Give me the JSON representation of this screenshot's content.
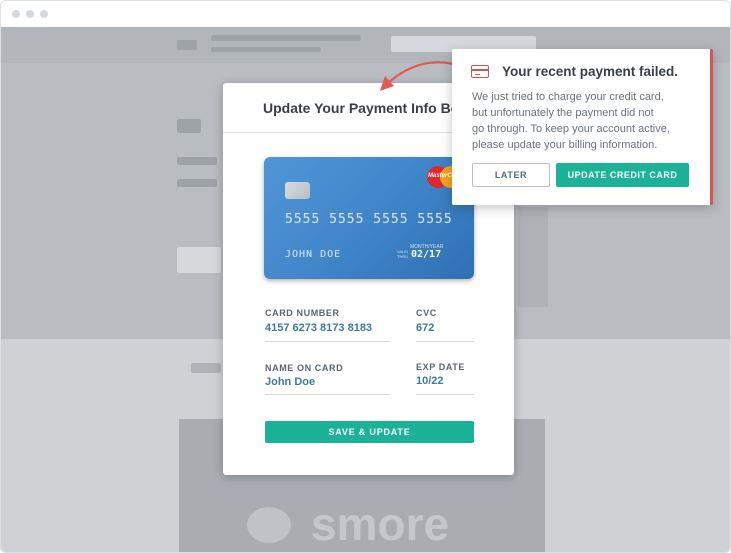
{
  "modal": {
    "title": "Update Your Payment Info Belo"
  },
  "card": {
    "number": "5555 5555 5555 5555",
    "holder": "JOHN DOE",
    "brand": "MasterCard",
    "valid_label": "MONTH/YEAR",
    "valid_thru": "VALID THRU",
    "expiry": "02/17"
  },
  "form": {
    "card_number_label": "CARD NUMBER",
    "card_number_value": "4157 6273 8173 8183",
    "cvc_label": "CVC",
    "cvc_value": "672",
    "name_label": "NAME ON CARD",
    "name_value": "John Doe",
    "exp_label": "EXP DATE",
    "exp_value": "10/22",
    "save_label": "SAVE & UPDATE"
  },
  "popover": {
    "title": "Your recent payment failed.",
    "body_lines": [
      "We just tried to charge your credit card,",
      "but unfortunately the payment did not",
      "go through. To keep your account active,",
      "please update your billing information."
    ],
    "later_label": "LATER",
    "update_label": "UPDATE CREDIT CARD",
    "icon": "credit-card-icon"
  },
  "background_logo": "smore",
  "colors": {
    "accent": "#1ab398",
    "alert": "#d9534f",
    "card_blue": "#3e84c8"
  }
}
